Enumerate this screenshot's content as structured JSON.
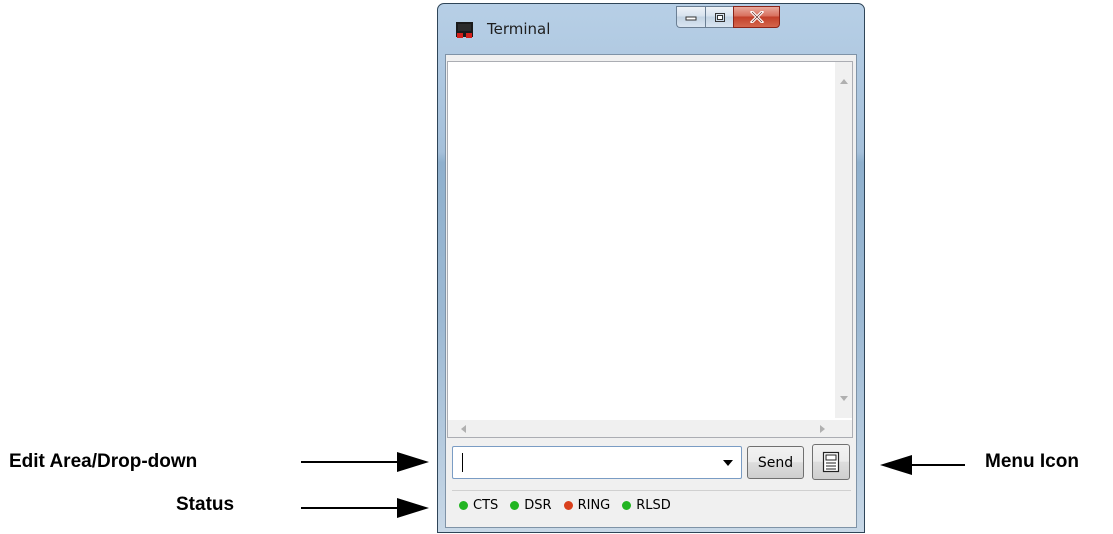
{
  "annotations": {
    "edit_area": "Edit Area/Drop-down",
    "status": "Status",
    "menu_icon": "Menu Icon"
  },
  "window": {
    "title": "Terminal",
    "icon": "terminal-icon"
  },
  "input": {
    "value": "",
    "placeholder": ""
  },
  "send_label": "Send",
  "menu_icon": "menu-document-icon",
  "status": [
    {
      "label": "CTS",
      "color": "#22b522"
    },
    {
      "label": "DSR",
      "color": "#22b522"
    },
    {
      "label": "RING",
      "color": "#d9401d"
    },
    {
      "label": "RLSD",
      "color": "#22b522"
    }
  ]
}
